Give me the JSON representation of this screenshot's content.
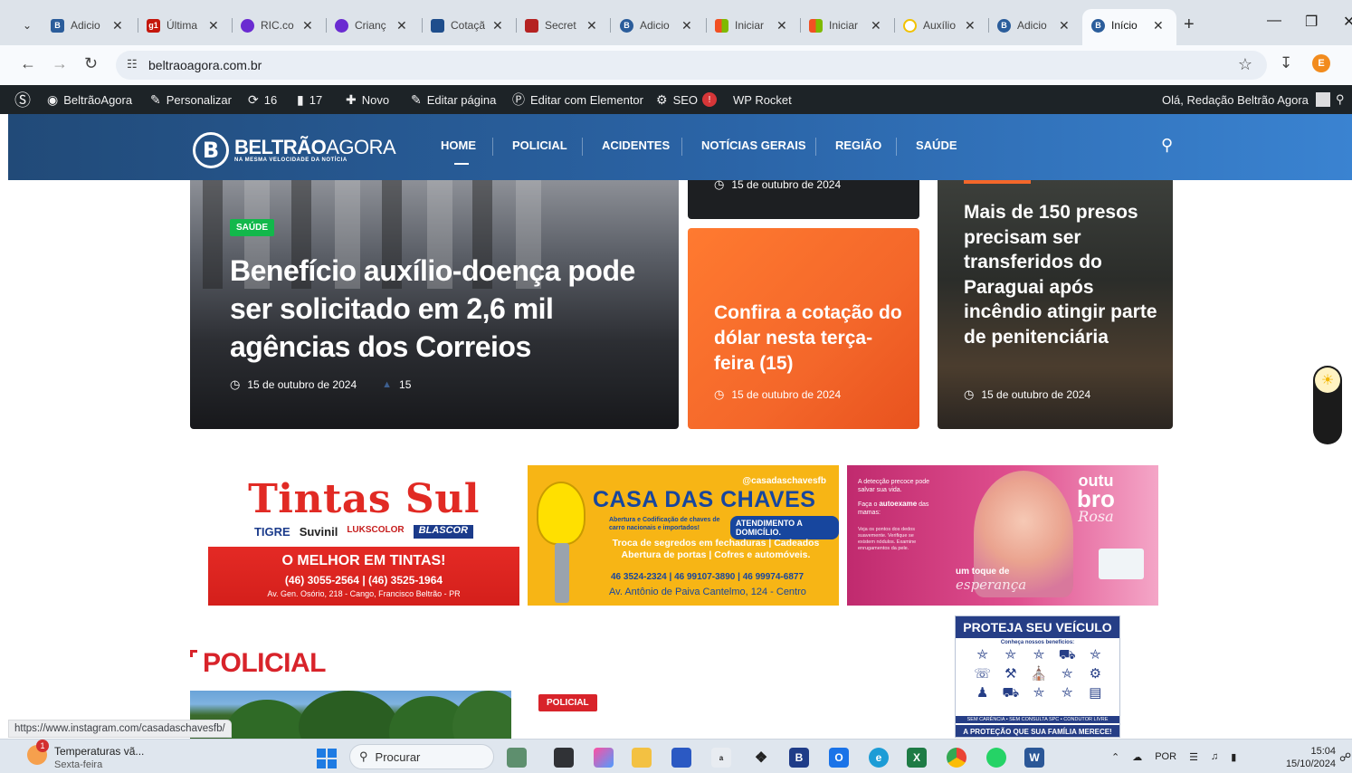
{
  "browser": {
    "tabs": [
      {
        "title": "Adicio",
        "icon": "site-icon",
        "color": "#2b5d9b"
      },
      {
        "title": "Última",
        "icon": "g1-icon",
        "color": "#c4170c"
      },
      {
        "title": "RIC.co",
        "icon": "ric-icon",
        "color": "#6a2bd1"
      },
      {
        "title": "Crianç",
        "icon": "sbt-icon",
        "color": "#6a2bd1"
      },
      {
        "title": "Cotaçã",
        "icon": "news-icon",
        "color": "#1f4e8c"
      },
      {
        "title": "Secret",
        "icon": "shield-icon",
        "color": "#b52222"
      },
      {
        "title": "Adicio",
        "icon": "site-icon",
        "color": "#2b5d9b"
      },
      {
        "title": "Iniciar",
        "icon": "windows-icon",
        "color": "#f25022"
      },
      {
        "title": "Iniciar",
        "icon": "windows-icon",
        "color": "#f25022"
      },
      {
        "title": "Auxílio",
        "icon": "circle-icon",
        "color": "#f2c200"
      },
      {
        "title": "Adicio",
        "icon": "site-icon",
        "color": "#2b5d9b"
      },
      {
        "title": "Início",
        "icon": "site-icon",
        "color": "#2b5d9b",
        "active": true
      }
    ],
    "url": "beltraoagora.com.br",
    "profile_initial": "E"
  },
  "wp_admin": {
    "site_name": "BeltrãoAgora",
    "customize": "Personalizar",
    "updates_count": "16",
    "comments_count": "17",
    "new": "Novo",
    "edit_page": "Editar página",
    "edit_elementor": "Editar com Elementor",
    "seo": "SEO",
    "seo_badge": "!",
    "wp_rocket": "WP Rocket",
    "greeting": "Olá, Redação Beltrão Agora"
  },
  "site": {
    "logo_name_bold": "BELTRÃO",
    "logo_name_light": "AGORA",
    "logo_tagline": "NA MESMA VELOCIDADE DA NOTÍCIA",
    "nav": [
      "HOME",
      "POLICIAL",
      "ACIDENTES",
      "NOTÍCIAS GERAIS",
      "REGIÃO",
      "SAÚDE"
    ]
  },
  "featured": {
    "main": {
      "category": "SAÚDE",
      "title": "Benefício auxílio-doença pode ser solicitado em 2,6 mil agências dos Correios",
      "date": "15 de outubro de 2024",
      "views": "15"
    },
    "top": {
      "date": "15 de outubro de 2024"
    },
    "orange": {
      "title": "Confira a cotação do dólar nesta terça-feira (15)",
      "date": "15 de outubro de 2024"
    },
    "dark": {
      "title": "Mais de 150 presos precisam ser transferidos do Paraguai após incêndio atingir parte de penitenciária",
      "date": "15 de outubro de 2024"
    }
  },
  "ads": {
    "tintas": {
      "title": "Tintas Sul",
      "brands": [
        "TIGRE",
        "Suvinil",
        "LUKSCOLOR",
        "BLASCOR"
      ],
      "slogan": "O MELHOR EM TINTAS!",
      "phones": "(46) 3055-2564 | (46) 3525-1964",
      "address": "Av. Gen. Osório, 218 - Cango, Francisco Beltrão - PR"
    },
    "chaves": {
      "instagram": "@casadaschavesfb",
      "title": "CASA DAS CHAVES",
      "sub": "Abertura e Codificação de chaves de carro nacionais e importados!",
      "pill": "ATENDIMENTO A DOMICÍLIO.",
      "services": "Troca de segredos em fechaduras | Cadeados Abertura de portas | Cofres e automóveis.",
      "phones": "46 3524-2324 | 46 99107-3890 | 46 99974-6877",
      "address": "Av. Antônio de Paiva Cantelmo, 124 - Centro"
    },
    "outubro": {
      "intro": "A detecção precoce pode salvar sua vida.",
      "cta_pre": "Faça o",
      "cta_bold": "autoexame",
      "cta_post": "das mamas:",
      "steps": "Veja os pontos dos dedos suavemente. Verifique se existem nódulos. Examine enrugamentos da pele.",
      "logo_top": "outu",
      "logo_bottom": "bro",
      "logo_script": "Rosa",
      "tagline": "um toque de",
      "tagline_script": "esperança"
    },
    "veiculo": {
      "title": "PROTEJA SEU VEÍCULO",
      "sub": "Conheça nossos benefícios:",
      "footer1": "SEM CARÊNCIA • SEM CONSULTA SPC • CONDUTOR LIVRE",
      "footer2": "A PROTEÇÃO QUE SUA FAMÍLIA MERECE!"
    }
  },
  "section": {
    "title": "POLICIAL",
    "badge": "POLICIAL"
  },
  "status_url": "https://www.instagram.com/casadaschavesfb/",
  "taskbar": {
    "weather_title": "Temperaturas vã...",
    "weather_day": "Sexta-feira",
    "weather_alert": "1",
    "search": "Procurar",
    "lang": "POR",
    "time": "15:04",
    "date": "15/10/2024"
  }
}
